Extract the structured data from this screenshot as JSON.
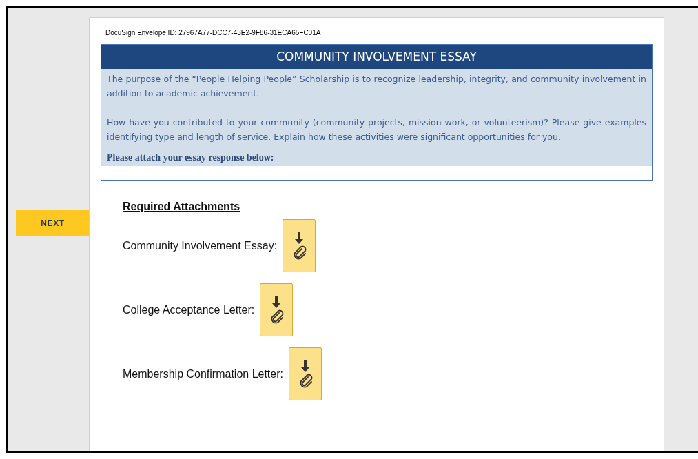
{
  "envelope_id": "DocuSign Envelope ID: 27967A77-DCC7-43E2-9F86-31ECA65FC01A",
  "next_button": "NEXT",
  "essay_box": {
    "title": "COMMUNITY INVOLVEMENT ESSAY",
    "paragraphs": [
      "The purpose of the “People Helping People” Scholarship is to recognize leadership, integrity, and community involvement in addition to academic achievement.",
      "How have you contributed to your community (community projects, mission work, or volunteerism)? Please give examples identifying type and length of service.  Explain how these activities were significant opportunities for you."
    ],
    "instruction": "Please attach your essay response below:"
  },
  "attachments": {
    "heading": "Required Attachments",
    "items": [
      {
        "label": "Community Involvement Essay:"
      },
      {
        "label": "College Acceptance Letter:"
      },
      {
        "label": "Membership Confirmation Letter:"
      }
    ]
  }
}
